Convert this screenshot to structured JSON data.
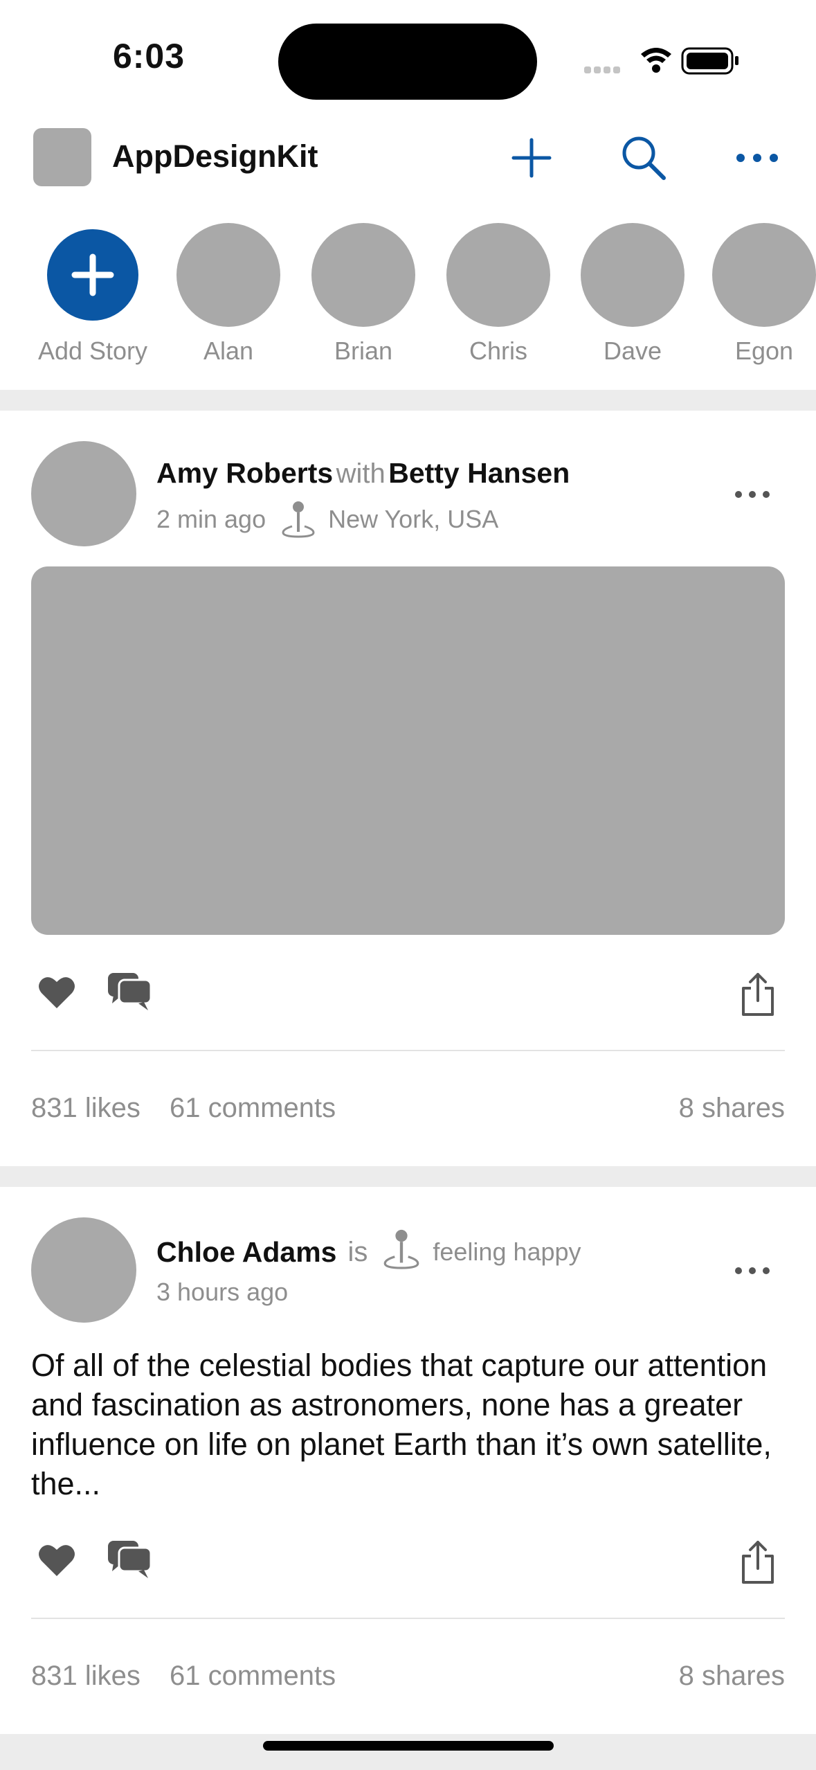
{
  "status_bar": {
    "time": "6:03"
  },
  "header": {
    "title": "AppDesignKit",
    "icons": [
      "plus-icon",
      "search-icon",
      "more-horizontal-icon"
    ]
  },
  "stories": [
    {
      "label": "Add Story"
    },
    {
      "label": "Alan"
    },
    {
      "label": "Brian"
    },
    {
      "label": "Chris"
    },
    {
      "label": "Dave"
    },
    {
      "label": "Egon"
    }
  ],
  "posts": [
    {
      "author": "Amy Roberts",
      "connector": "with",
      "tagged": "Betty Hansen",
      "time": "2 min ago",
      "location": "New York, USA",
      "likes": "831 likes",
      "comments": "61 comments",
      "shares": "8 shares"
    },
    {
      "author": "Chloe Adams",
      "connector": "is",
      "feeling": "feeling happy",
      "time": "3 hours ago",
      "text": "Of all of the celestial bodies that capture our attention and fascination as astronomers, none has a greater influence on life on planet Earth than it’s own satellite, the...",
      "likes": "831 likes",
      "comments": "61 comments",
      "shares": "8 shares"
    }
  ],
  "colors": {
    "accent": "#0b57a4",
    "placeholder": "#a9a9a9",
    "secondary_text": "#8e8e8e",
    "divider_band": "#ececec"
  }
}
